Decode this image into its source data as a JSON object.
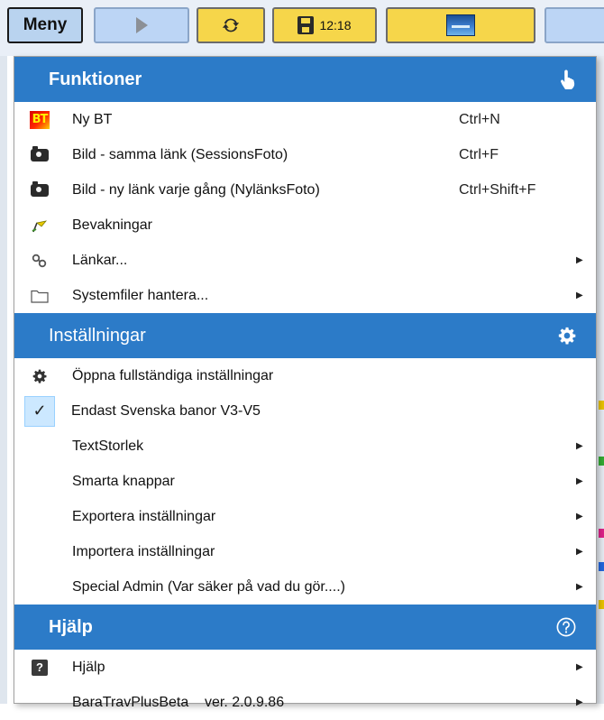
{
  "toolbar": {
    "menu_label": "Meny",
    "clock": "12:18",
    "icons": [
      "play-icon",
      "sync-icon",
      "save-icon",
      "image-icon"
    ]
  },
  "colors": {
    "section_header": "#2c7bc8",
    "toolbar_yellow": "#f6d64a",
    "toolbar_blue": "#bcd5f5",
    "selected_bg": "#cce8ff"
  },
  "sections": {
    "funktioner": {
      "title": "Funktioner",
      "icon": "hand-pointer-icon",
      "items": [
        {
          "label": "Ny BT",
          "shortcut": "Ctrl+N",
          "icon": "bt-icon"
        },
        {
          "label": "Bild - samma länk (SessionsFoto)",
          "shortcut": "Ctrl+F",
          "icon": "camera-icon"
        },
        {
          "label": "Bild - ny länk varje gång (NylänksFoto)",
          "shortcut": "Ctrl+Shift+F",
          "icon": "camera-icon"
        },
        {
          "label": "Bevakningar",
          "shortcut": "",
          "icon": "flag-icon"
        },
        {
          "label": "Länkar...",
          "shortcut": "",
          "icon": "link-icon",
          "submenu": true
        },
        {
          "label": "Systemfiler hantera...",
          "shortcut": "",
          "icon": "folder-icon",
          "submenu": true
        }
      ]
    },
    "installningar": {
      "title": "Inställningar",
      "icon": "gear-icon",
      "items": [
        {
          "label": "Öppna fullständiga inställningar",
          "icon": "gear-icon"
        },
        {
          "label": "Endast Svenska banor V3-V5",
          "icon": "check-icon",
          "checked": true
        },
        {
          "label": "TextStorlek",
          "submenu": true
        },
        {
          "label": "Smarta knappar",
          "submenu": true
        },
        {
          "label": "Exportera inställningar",
          "submenu": true
        },
        {
          "label": "Importera inställningar",
          "submenu": true
        },
        {
          "label": "Special Admin (Var säker på vad du gör....)",
          "submenu": true
        }
      ]
    },
    "hjalp": {
      "title": "Hjälp",
      "icon": "help-circle-icon",
      "items": [
        {
          "label": "Hjälp",
          "icon": "help-square-icon",
          "submenu": true
        },
        {
          "label": "BaraTravPlusBeta    ver. 2.0.9.86",
          "submenu": true
        }
      ]
    }
  },
  "glyphs": {
    "submenu_arrow": "▶",
    "check": "✓",
    "help_square": "?"
  }
}
